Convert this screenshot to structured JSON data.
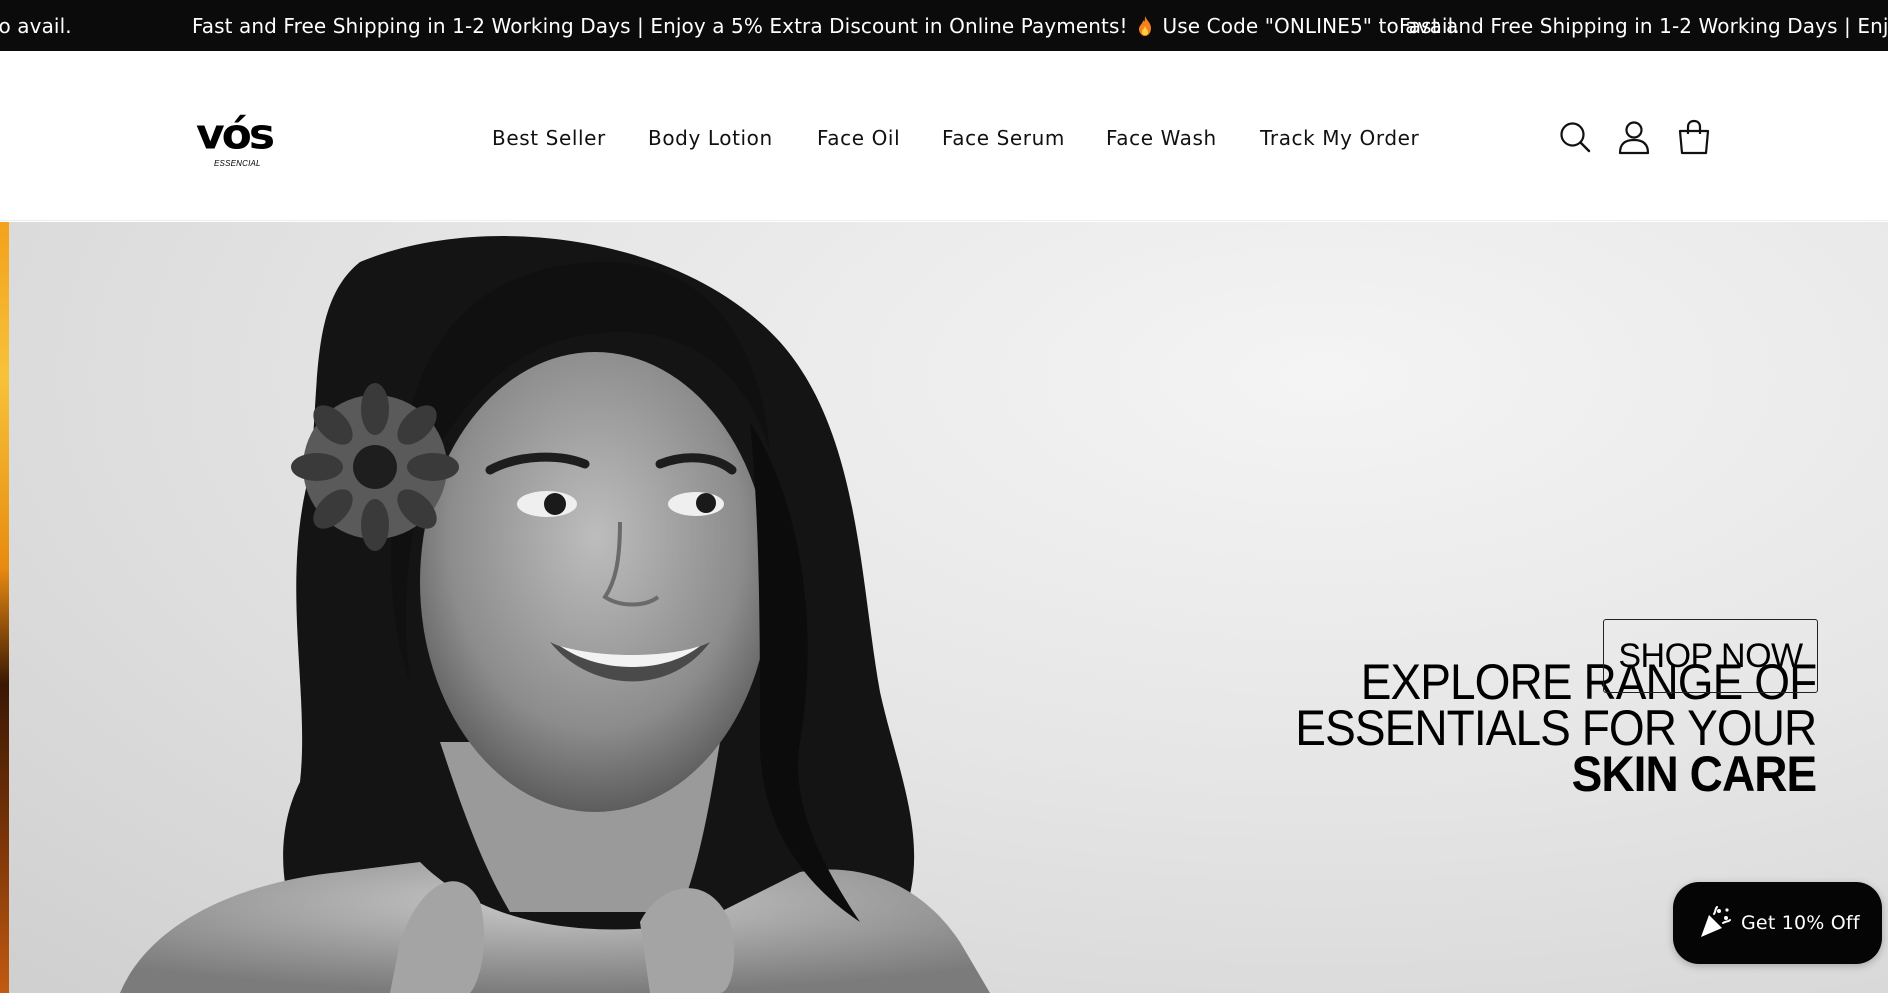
{
  "announcement": {
    "text_1": "Fast and Free Shipping in 1-2 Working Days | Enjoy a 5% Extra Discount in Online Payments!",
    "text_2": "Use Code \"ONLINE5\" to avail.",
    "icon": "flame-icon"
  },
  "header": {
    "logo_word": "vós",
    "logo_sub": "ESSENCIAL",
    "nav": [
      {
        "label": "Best Seller"
      },
      {
        "label": "Body Lotion"
      },
      {
        "label": "Face Oil"
      },
      {
        "label": "Face Serum"
      },
      {
        "label": "Face Wash"
      },
      {
        "label": "Track My Order"
      }
    ],
    "icons": [
      "search-icon",
      "account-icon",
      "cart-icon"
    ]
  },
  "hero": {
    "line_1": "EXPLORE RANGE OF",
    "line_2": "ESSENTIALS FOR YOUR",
    "line_3": "SKIN CARE",
    "cta": "SHOP NOW"
  },
  "discount_popup": {
    "label": "Get 10% Off",
    "icon": "party-popper-icon"
  },
  "colors": {
    "announcement_bg": "#0b0b0b",
    "text": "#111111",
    "accent_edge": "#f3a11a"
  }
}
